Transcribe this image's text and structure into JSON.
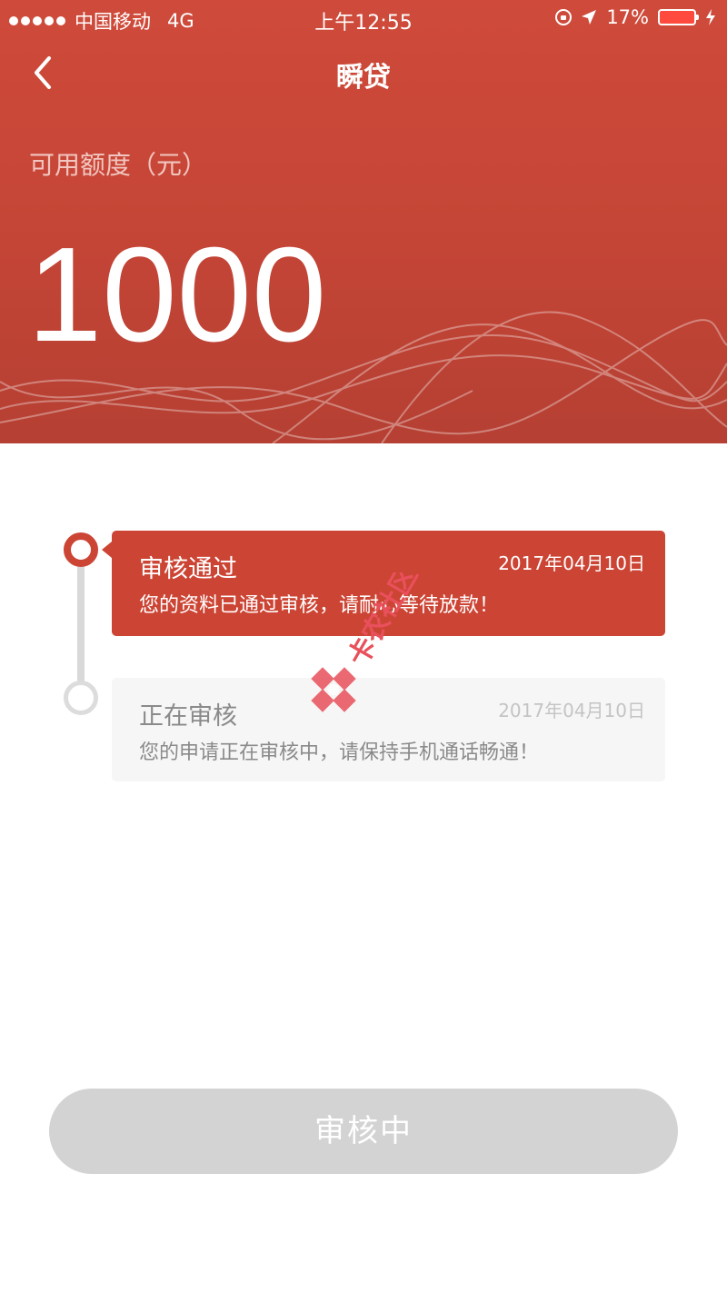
{
  "status_bar": {
    "carrier": "中国移动",
    "network": "4G",
    "time": "上午12:55",
    "battery": "17%",
    "icons": [
      "signal-dots-icon",
      "orientation-lock-icon",
      "location-arrow-icon",
      "battery-icon",
      "charging-icon"
    ]
  },
  "nav": {
    "title": "瞬贷",
    "back_icon": "chevron-left-icon"
  },
  "credit": {
    "label": "可用额度（元）",
    "amount": "1000"
  },
  "timeline": [
    {
      "title": "审核通过",
      "date": "2017年04月10日",
      "desc": "您的资料已通过审核，请耐心等待放款！",
      "state": "active"
    },
    {
      "title": "正在审核",
      "date": "2017年04月10日",
      "desc": "您的申请正在审核中，请保持手机通话畅通！",
      "state": "pending"
    }
  ],
  "watermark": {
    "text": "卡农社区"
  },
  "action": {
    "button_label": "审核中"
  },
  "colors": {
    "brand_red": "#cc4434",
    "pending_gray": "#d3d3d3",
    "card_pending_bg": "#f6f6f6"
  }
}
